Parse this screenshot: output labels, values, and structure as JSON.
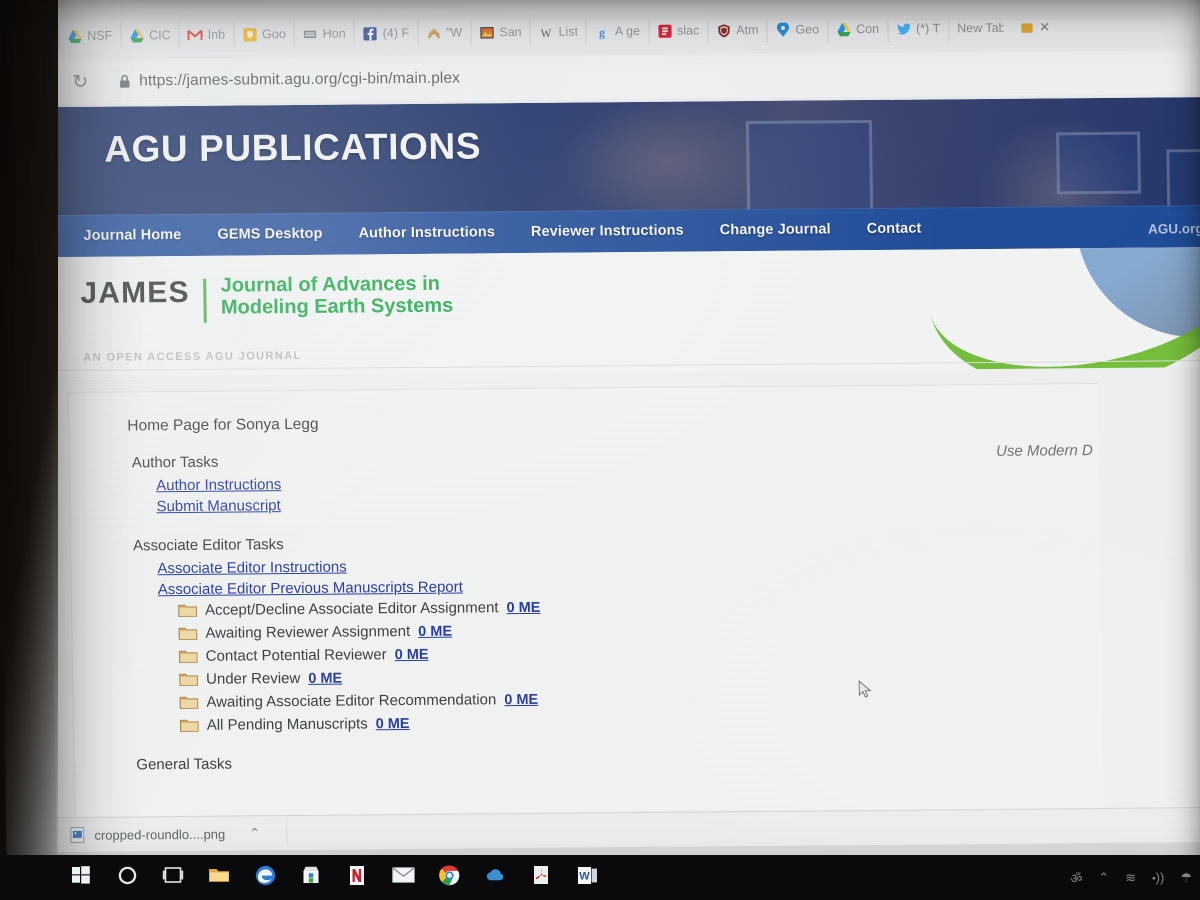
{
  "browser": {
    "url": "https://james-submit.agu.org/cgi-bin/main.plex",
    "back_icon": "back-arrow-icon",
    "forward_icon": "forward-arrow-icon",
    "reload_icon": "reload-icon",
    "lock_icon": "lock-icon",
    "bookmarks": [
      {
        "label": "Goo",
        "icon": "google-calendar-icon"
      },
      {
        "label": "NSF",
        "icon": "google-drive-icon"
      },
      {
        "label": "CIC",
        "icon": "google-drive-icon"
      },
      {
        "label": "Inb",
        "icon": "gmail-icon"
      },
      {
        "label": "Goo",
        "icon": "google-keep-icon"
      },
      {
        "label": "Hon",
        "icon": "generic-bookmark-icon"
      },
      {
        "label": "(4) F",
        "icon": "facebook-icon"
      },
      {
        "label": "\"W",
        "icon": "princeton-icon"
      },
      {
        "label": "San",
        "icon": "photo-icon"
      },
      {
        "label": "List",
        "icon": "wikipedia-icon"
      },
      {
        "label": "A ge",
        "icon": "scholar-icon"
      },
      {
        "label": "slac",
        "icon": "slack-icon"
      },
      {
        "label": "Atm",
        "icon": "shield-icon"
      },
      {
        "label": "Geo",
        "icon": "geo-icon"
      },
      {
        "label": "Con",
        "icon": "google-drive-icon"
      },
      {
        "label": "(*) T",
        "icon": "twitter-icon"
      },
      {
        "label": "New Tab",
        "icon": "none"
      }
    ],
    "profile_icon": "profile-icon",
    "close_icon": "close-icon"
  },
  "banner": {
    "title": "AGU PUBLICATIONS",
    "nav": [
      "Journal Home",
      "GEMS Desktop",
      "Author Instructions",
      "Reviewer Instructions",
      "Change Journal",
      "Contact"
    ],
    "corner_link": "AGU.org",
    "bg_color": "#1b2f66",
    "nav_color": "#204e9c"
  },
  "masthead": {
    "acronym": "JAMES",
    "full_title": "Journal of Advances in Modeling Earth Systems",
    "tagline": "AN OPEN ACCESS AGU JOURNAL",
    "accent_color": "#22a94b",
    "swoosh_color": "#6cbb2e"
  },
  "main": {
    "home_heading": "Home Page for Sonya Legg",
    "use_modern": "Use Modern D",
    "link_color": "#2a3fa0",
    "groups": [
      {
        "title": "Author Tasks",
        "links": [
          "Author Instructions",
          "Submit Manuscript"
        ],
        "folders": []
      },
      {
        "title": "Associate Editor Tasks",
        "links": [
          "Associate Editor Instructions",
          "Associate Editor Previous Manuscripts Report"
        ],
        "folders": [
          {
            "label": "Accept/Decline Associate Editor Assignment",
            "count": "0 ME"
          },
          {
            "label": "Awaiting Reviewer Assignment",
            "count": "0 ME"
          },
          {
            "label": "Contact Potential Reviewer",
            "count": "0 ME"
          },
          {
            "label": "Under Review",
            "count": "0 ME"
          },
          {
            "label": "Awaiting Associate Editor Recommendation",
            "count": "0 ME"
          },
          {
            "label": "All Pending Manuscripts",
            "count": "0 ME"
          }
        ]
      },
      {
        "title": "General Tasks",
        "links": [],
        "folders": []
      }
    ]
  },
  "download_shelf": {
    "file_name": "cropped-roundlo....png",
    "file_icon": "image-file-icon",
    "caret": "⌃"
  },
  "taskbar": {
    "items": [
      {
        "name": "start-button",
        "icon": "windows-logo-icon"
      },
      {
        "name": "cortana-button",
        "icon": "circle-icon"
      },
      {
        "name": "task-view-button",
        "icon": "task-view-icon"
      },
      {
        "name": "file-explorer-button",
        "icon": "folder-icon"
      },
      {
        "name": "edge-button",
        "icon": "edge-icon"
      },
      {
        "name": "store-button",
        "icon": "store-icon"
      },
      {
        "name": "onenote-button",
        "icon": "onenote-icon"
      },
      {
        "name": "mail-button",
        "icon": "mail-icon"
      },
      {
        "name": "chrome-button",
        "icon": "chrome-icon"
      },
      {
        "name": "weather-button",
        "icon": "cloud-icon"
      },
      {
        "name": "acrobat-button",
        "icon": "acrobat-icon"
      },
      {
        "name": "word-button",
        "icon": "word-icon"
      }
    ],
    "tray": [
      "ॐ",
      "⌃",
      "≋",
      "⬝))",
      "☂"
    ]
  }
}
